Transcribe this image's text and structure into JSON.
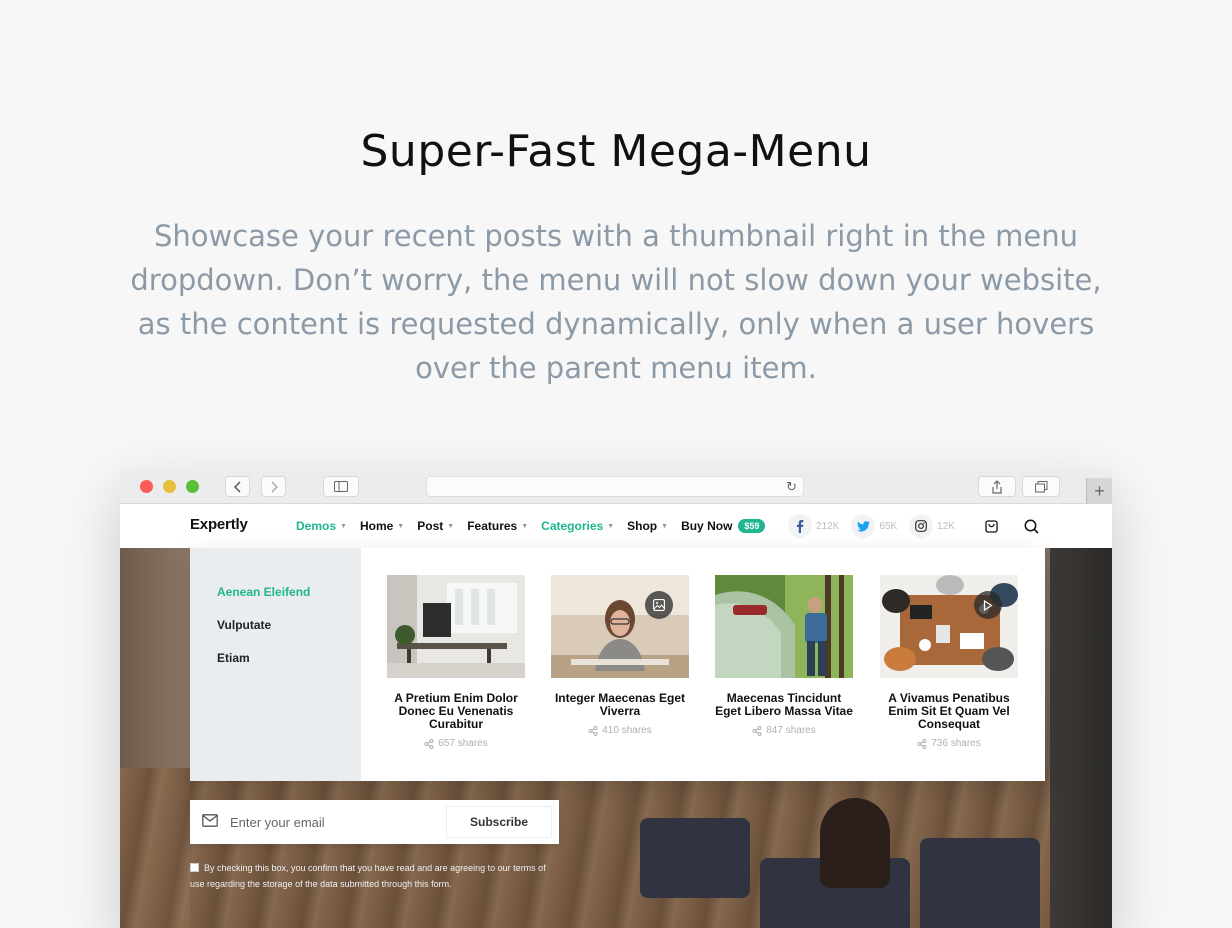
{
  "hero": {
    "title": "Super-Fast Mega-Menu",
    "description": "Showcase your recent posts with a thumbnail right in the menu dropdown. Don’t worry, the menu will not slow down your website, as the content is requested dynamically, only when a user hovers over the parent menu item."
  },
  "site": {
    "logo": "Expertly",
    "nav": [
      {
        "label": "Demos",
        "accent": true
      },
      {
        "label": "Home",
        "accent": false
      },
      {
        "label": "Post",
        "accent": false
      },
      {
        "label": "Features",
        "accent": false
      },
      {
        "label": "Categories",
        "accent": true
      },
      {
        "label": "Shop",
        "accent": false
      }
    ],
    "buy": {
      "label": "Buy Now",
      "price": "$59"
    },
    "socials": [
      {
        "name": "facebook-icon",
        "count": "212K",
        "color": "#3b5998"
      },
      {
        "name": "twitter-icon",
        "count": "65K",
        "color": "#1da1f2"
      },
      {
        "name": "instagram-icon",
        "count": "12K",
        "color": "#333333"
      }
    ]
  },
  "mega": {
    "sidebar": [
      {
        "label": "Aenean Eleifend",
        "active": true
      },
      {
        "label": "Vulputate",
        "active": false
      },
      {
        "label": "Etiam",
        "active": false
      }
    ],
    "posts": [
      {
        "title": "A Pretium Enim Dolor Donec Eu Venenatis Curabitur",
        "shares": "657 shares",
        "badge": ""
      },
      {
        "title": "Integer Maecenas Eget Viverra",
        "shares": "410 shares",
        "badge": "image-icon"
      },
      {
        "title": "Maecenas Tincidunt Eget Libero Massa Vitae",
        "shares": "847 shares",
        "badge": ""
      },
      {
        "title": "A Vivamus Penatibus Enim Sit Et Quam Vel Consequat",
        "shares": "736 shares",
        "badge": "play-icon"
      }
    ]
  },
  "subscribe": {
    "placeholder": "Enter your email",
    "button": "Subscribe",
    "consent": "By checking this box, you confirm that you have read and are agreeing to our terms of use regarding the storage of the data submitted through this form."
  },
  "colors": {
    "accent": "#1fb58f",
    "heading": "#111111",
    "muted": "#8c9aa8"
  }
}
